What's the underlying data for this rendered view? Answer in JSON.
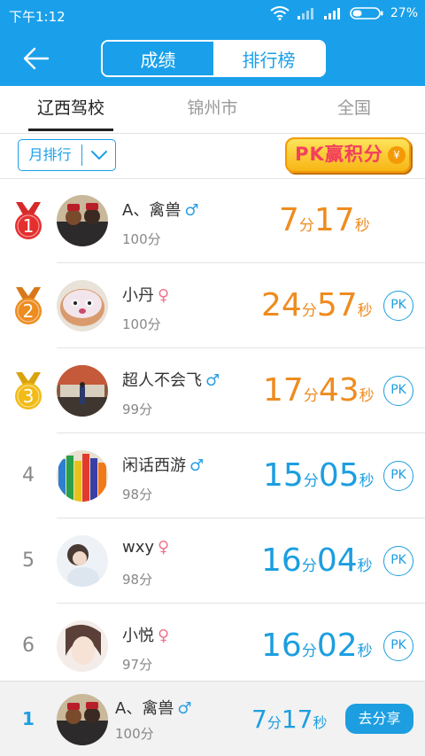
{
  "status": {
    "time": "下午1:12",
    "battery": "27%"
  },
  "header": {
    "seg_scores": "成绩",
    "seg_rank": "排行榜"
  },
  "tabs": [
    "辽西驾校",
    "锦州市",
    "全国"
  ],
  "filter": {
    "label": "月排行"
  },
  "pk_banner": {
    "text": "PK赢积分",
    "coin": "¥"
  },
  "units": {
    "min": "分",
    "sec": "秒"
  },
  "pk_label": "PK",
  "rows": [
    {
      "rank": "1",
      "name": "A、禽兽",
      "gender": "♂",
      "points": "100分",
      "min": "7",
      "sec": "17"
    },
    {
      "rank": "2",
      "name": "小丹",
      "gender": "♀",
      "points": "100分",
      "min": "24",
      "sec": "57"
    },
    {
      "rank": "3",
      "name": "超人不会飞",
      "gender": "♂",
      "points": "99分",
      "min": "17",
      "sec": "43"
    },
    {
      "rank": "4",
      "name": "闲话西游",
      "gender": "♂",
      "points": "98分",
      "min": "15",
      "sec": "05"
    },
    {
      "rank": "5",
      "name": "wxy",
      "gender": "♀",
      "points": "98分",
      "min": "16",
      "sec": "04"
    },
    {
      "rank": "6",
      "name": "小悦",
      "gender": "♀",
      "points": "97分",
      "min": "16",
      "sec": "02"
    }
  ],
  "me": {
    "rank": "1",
    "name": "A、禽兽",
    "gender": "♂",
    "points": "100分",
    "min": "7",
    "sec": "17",
    "share": "去分享"
  },
  "colors": {
    "primary": "#1aa0ea",
    "gold": "#f2bb16",
    "silver": "#ee8c20",
    "bronze": "#e52f2f"
  }
}
